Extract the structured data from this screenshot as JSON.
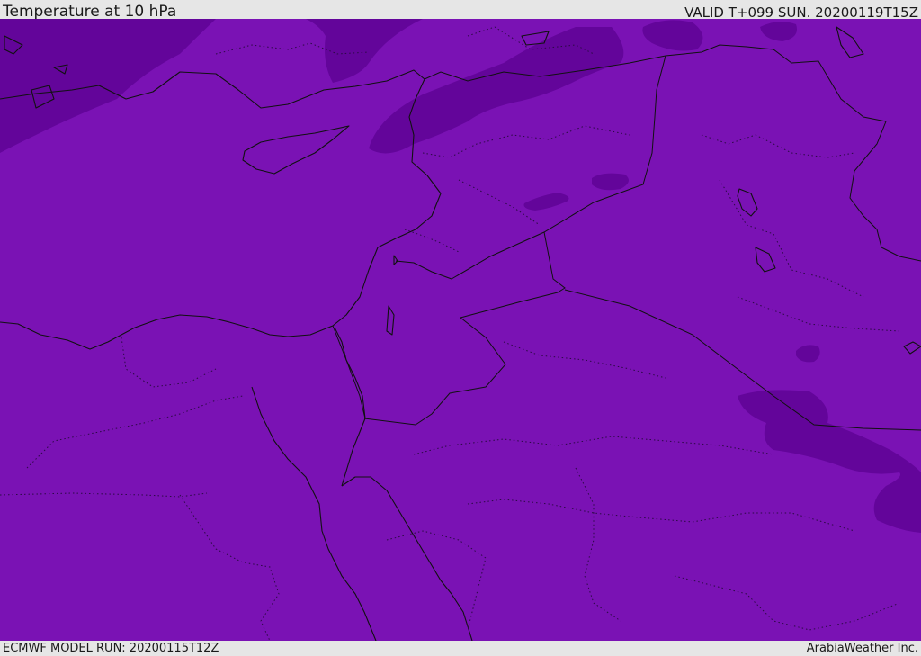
{
  "header": {
    "title": "Temperature at 10 hPa",
    "valid_time": "VALID T+099 SUN. 20200119T15Z"
  },
  "footer": {
    "model_run": "ECMWF MODEL RUN: 20200115T12Z",
    "credit": "ArabiaWeather Inc."
  },
  "map": {
    "colors": {
      "base_fill": "#7a12b4",
      "dark_fill": "#63059a",
      "coastline": "#111111",
      "border": "#111111",
      "province": "#2b0a44"
    }
  }
}
